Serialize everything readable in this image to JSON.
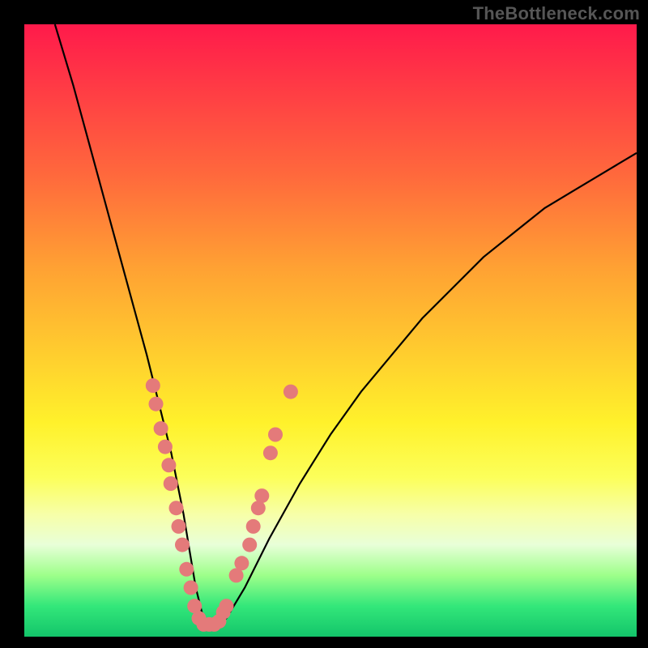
{
  "attribution": "TheBottleneck.com",
  "colors": {
    "dot_fill": "#e47a7a",
    "curve_stroke": "#000000"
  },
  "chart_data": {
    "type": "line",
    "title": "",
    "xlabel": "",
    "ylabel": "",
    "xlim": [
      0,
      100
    ],
    "ylim": [
      0,
      100
    ],
    "grid": false,
    "legend": false,
    "series": [
      {
        "name": "bottleneck-curve",
        "x": [
          5,
          8,
          11,
          14,
          17,
          20,
          22,
          24,
          25,
          26,
          27,
          28,
          29,
          30,
          31,
          33,
          36,
          40,
          45,
          50,
          55,
          60,
          65,
          70,
          75,
          80,
          85,
          90,
          95,
          100
        ],
        "y": [
          100,
          90,
          79,
          68,
          57,
          46,
          38,
          30,
          25,
          20,
          14,
          8,
          4,
          2,
          2,
          3,
          8,
          16,
          25,
          33,
          40,
          46,
          52,
          57,
          62,
          66,
          70,
          73,
          76,
          79
        ]
      }
    ],
    "points": [
      {
        "x": 21.0,
        "y": 41
      },
      {
        "x": 21.5,
        "y": 38
      },
      {
        "x": 22.3,
        "y": 34
      },
      {
        "x": 23.0,
        "y": 31
      },
      {
        "x": 23.6,
        "y": 28
      },
      {
        "x": 23.9,
        "y": 25
      },
      {
        "x": 24.8,
        "y": 21
      },
      {
        "x": 25.2,
        "y": 18
      },
      {
        "x": 25.8,
        "y": 15
      },
      {
        "x": 26.5,
        "y": 11
      },
      {
        "x": 27.2,
        "y": 8
      },
      {
        "x": 27.8,
        "y": 5
      },
      {
        "x": 28.5,
        "y": 3
      },
      {
        "x": 29.3,
        "y": 2
      },
      {
        "x": 30.2,
        "y": 2
      },
      {
        "x": 31.0,
        "y": 2
      },
      {
        "x": 31.8,
        "y": 2.5
      },
      {
        "x": 32.5,
        "y": 4
      },
      {
        "x": 33.0,
        "y": 5
      },
      {
        "x": 34.6,
        "y": 10
      },
      {
        "x": 35.5,
        "y": 12
      },
      {
        "x": 36.8,
        "y": 15
      },
      {
        "x": 37.4,
        "y": 18
      },
      {
        "x": 38.2,
        "y": 21
      },
      {
        "x": 38.8,
        "y": 23
      },
      {
        "x": 40.2,
        "y": 30
      },
      {
        "x": 41.0,
        "y": 33
      },
      {
        "x": 43.5,
        "y": 40
      }
    ]
  }
}
